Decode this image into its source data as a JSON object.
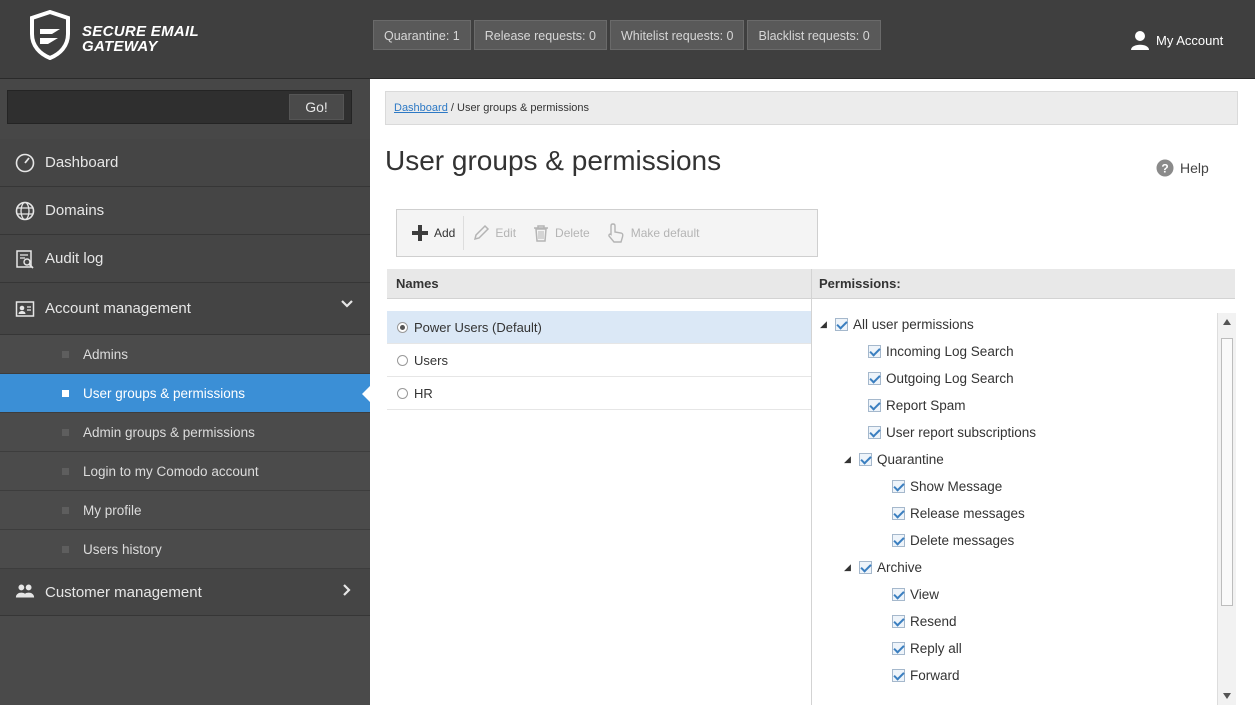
{
  "app": {
    "logo_line1": "SECURE EMAIL",
    "logo_line2": "GATEWAY"
  },
  "topbar": {
    "counters": [
      {
        "label": "Quarantine: 1"
      },
      {
        "label": "Release requests: 0"
      },
      {
        "label": "Whitelist requests: 0"
      },
      {
        "label": "Blacklist requests: 0"
      }
    ],
    "account_label": "My Account"
  },
  "sidebar": {
    "search": {
      "value": "",
      "go_label": "Go!"
    },
    "items": [
      {
        "label": "Dashboard",
        "icon": "dashboard-icon"
      },
      {
        "label": "Domains",
        "icon": "globe-icon"
      },
      {
        "label": "Audit log",
        "icon": "audit-log-icon"
      },
      {
        "label": "Account management",
        "icon": "account-card-icon",
        "expanded": true
      }
    ],
    "subitems": [
      {
        "label": "Admins"
      },
      {
        "label": "User groups & permissions",
        "active": true
      },
      {
        "label": "Admin groups & permissions"
      },
      {
        "label": "Login to my Comodo account"
      },
      {
        "label": "My profile"
      },
      {
        "label": "Users history"
      }
    ],
    "customer_management": {
      "label": "Customer management",
      "icon": "people-icon"
    }
  },
  "main": {
    "breadcrumb": {
      "link": "Dashboard",
      "rest": " / User groups & permissions"
    },
    "title": "User groups & permissions",
    "help_label": "Help",
    "toolbar": {
      "add": "Add",
      "edit": "Edit",
      "delete": "Delete",
      "make_default": "Make default"
    },
    "names_header": "Names",
    "permissions_header": "Permissions:",
    "groups": [
      {
        "name": "Power Users (Default)",
        "selected": true
      },
      {
        "name": "Users",
        "selected": false
      },
      {
        "name": "HR",
        "selected": false
      }
    ],
    "permissions": [
      {
        "label": "All user permissions",
        "level": 0,
        "expandable": true
      },
      {
        "label": "Incoming Log Search",
        "level": 1
      },
      {
        "label": "Outgoing Log Search",
        "level": 1
      },
      {
        "label": "Report Spam",
        "level": 1
      },
      {
        "label": "User report subscriptions",
        "level": 1
      },
      {
        "label": "Quarantine",
        "level": 1,
        "expandable": true
      },
      {
        "label": "Show Message",
        "level": 2
      },
      {
        "label": "Release messages",
        "level": 2
      },
      {
        "label": "Delete messages",
        "level": 2
      },
      {
        "label": "Archive",
        "level": 1,
        "expandable": true
      },
      {
        "label": "View",
        "level": 2
      },
      {
        "label": "Resend",
        "level": 2
      },
      {
        "label": "Reply all",
        "level": 2
      },
      {
        "label": "Forward",
        "level": 2
      }
    ]
  },
  "colors": {
    "active_nav": "#3b8fd6",
    "topbar": "#3f3f3f",
    "sidebar": "#3b3b3b"
  }
}
